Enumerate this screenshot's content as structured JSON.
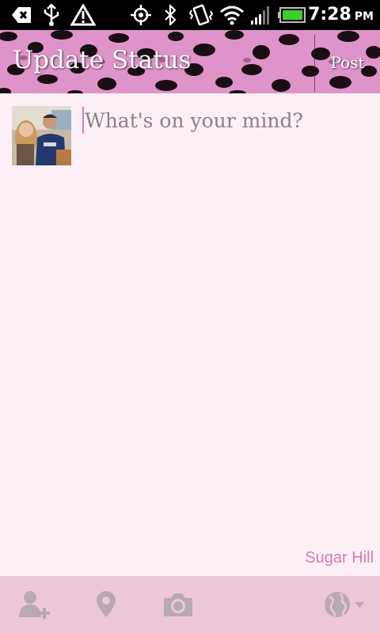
{
  "status_bar": {
    "time": "7:28",
    "ampm": "PM",
    "battery_color": "#3ecf2a"
  },
  "header": {
    "title": "Update Status",
    "post_label": "Post"
  },
  "compose": {
    "placeholder": "What's on your mind?",
    "value": "",
    "location_label": "Sugar Hill"
  },
  "toolbar": {
    "icons": [
      "add-friend-icon",
      "location-pin-icon",
      "camera-icon",
      "globe-privacy-icon"
    ]
  },
  "theme": {
    "accent": "#d37cb3",
    "background": "#fcf0f6",
    "toolbar": "#ecc7da"
  }
}
